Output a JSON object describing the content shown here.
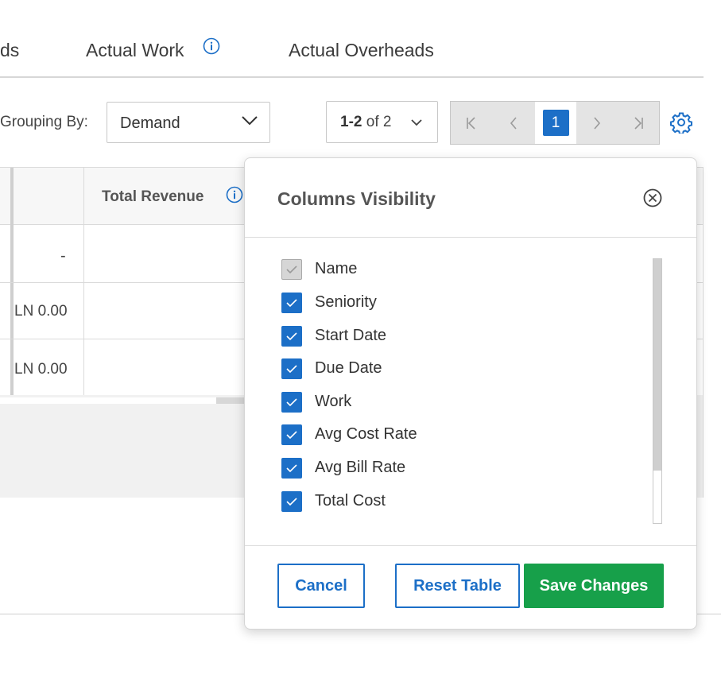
{
  "tabs": [
    {
      "label": "ds"
    },
    {
      "label": "Actual Work"
    },
    {
      "label": "Actual Overheads"
    }
  ],
  "toolbar": {
    "grouping_label": "Grouping By:",
    "grouping_value": "Demand",
    "page_range_bold": "1-2",
    "page_range_rest": " of 2",
    "current_page": "1"
  },
  "table": {
    "column_title": "Total Revenue",
    "group_value": "-",
    "rows": [
      {
        "value": "LN 0.00"
      },
      {
        "value": "LN 0.00"
      }
    ]
  },
  "modal": {
    "title": "Columns Visibility",
    "options": [
      {
        "label": "Name",
        "checked": true,
        "disabled": true
      },
      {
        "label": "Seniority",
        "checked": true,
        "disabled": false
      },
      {
        "label": "Start Date",
        "checked": true,
        "disabled": false
      },
      {
        "label": "Due Date",
        "checked": true,
        "disabled": false
      },
      {
        "label": "Work",
        "checked": true,
        "disabled": false
      },
      {
        "label": "Avg Cost Rate",
        "checked": true,
        "disabled": false
      },
      {
        "label": "Avg Bill Rate",
        "checked": true,
        "disabled": false
      },
      {
        "label": "Total Cost",
        "checked": true,
        "disabled": false
      }
    ],
    "cancel_label": "Cancel",
    "reset_label": "Reset Table",
    "save_label": "Save Changes"
  },
  "colors": {
    "accent": "#1c6fc7",
    "save": "#17a04a"
  }
}
